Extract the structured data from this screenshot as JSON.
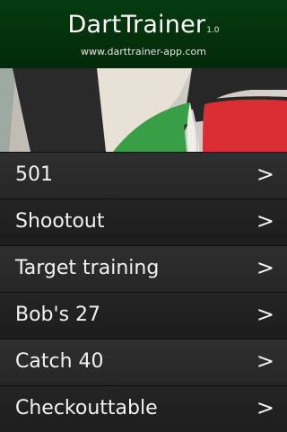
{
  "header": {
    "title": "DartTrainer",
    "version": "1.0",
    "url": "www.darttrainer-app.com"
  },
  "banner": {
    "description_icon": "dartboard-image",
    "colors": {
      "red": "#d8232a",
      "green": "#2e9a3e",
      "black": "#1c1c1c",
      "cream": "#e8e2d6"
    }
  },
  "menu": {
    "items": [
      {
        "label": "501",
        "arrow": ">"
      },
      {
        "label": "Shootout",
        "arrow": ">"
      },
      {
        "label": "Target training",
        "arrow": ">"
      },
      {
        "label": "Bob's 27",
        "arrow": ">"
      },
      {
        "label": "Catch 40",
        "arrow": ">"
      },
      {
        "label": "Checkouttable",
        "arrow": ">"
      }
    ]
  },
  "colors": {
    "header_bg": "#043a10",
    "row_bg": "#2a2a2a",
    "text": "#f2f2f2"
  }
}
